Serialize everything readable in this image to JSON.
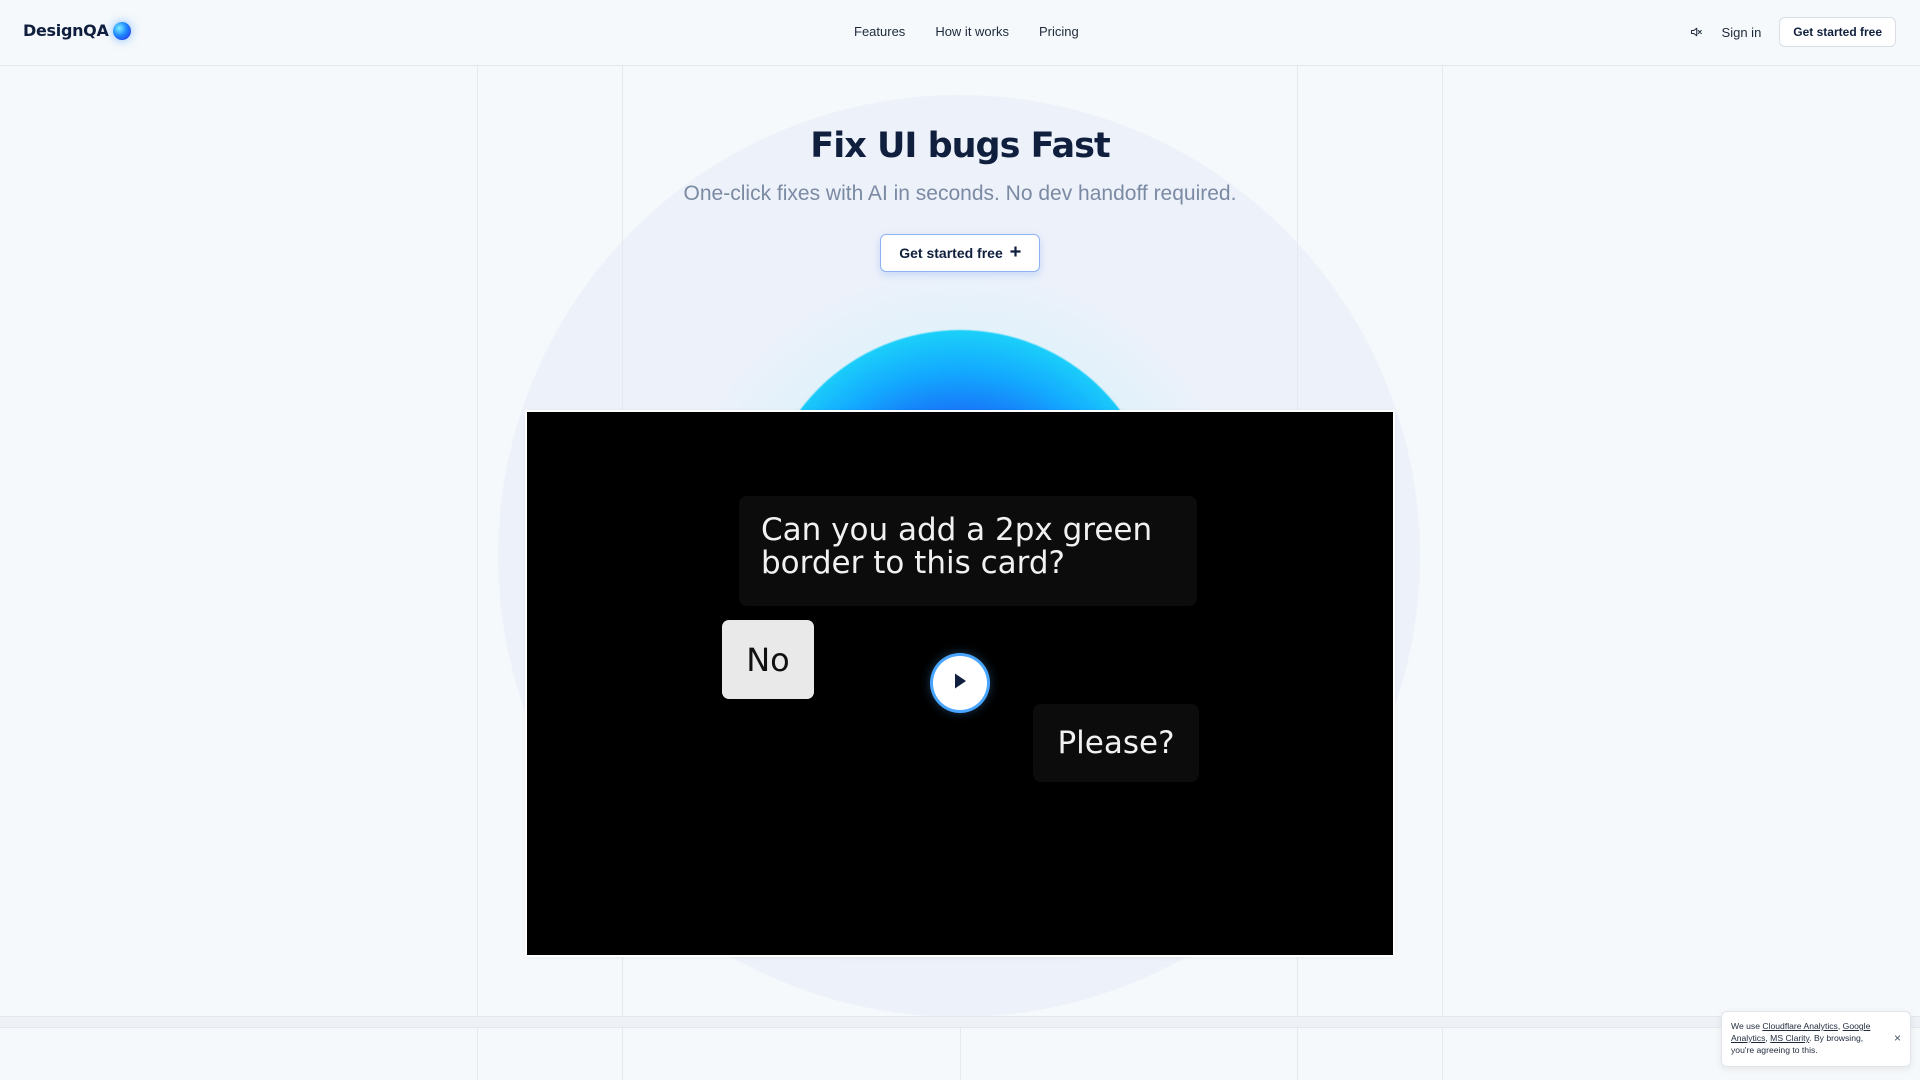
{
  "header": {
    "logo_text": "DesignQA",
    "nav": [
      "Features",
      "How it works",
      "Pricing"
    ],
    "mute_icon": "volume-mute-icon",
    "signin_label": "Sign in",
    "cta_label": "Get started free"
  },
  "hero": {
    "title": "Fix UI bugs Fast",
    "subtitle": "One-click fixes with AI in seconds. No dev handoff required.",
    "cta_label": "Get started free",
    "cta_icon": "plus-icon"
  },
  "video": {
    "question": "Can you add a 2px green border to this card?",
    "reply_no": "No",
    "reply_please": "Please?",
    "play_icon": "play-icon"
  },
  "cookie": {
    "prefix": "We use ",
    "link1": "Cloudflare Analytics",
    "sep1": ", ",
    "link2": "Google Analytics",
    "sep2": ", ",
    "link3": "MS Clarity",
    "suffix": ". By browsing, you're agreeing to this.",
    "close": "×"
  },
  "colors": {
    "background": "#f6f9fb",
    "heading": "#0f1f3d",
    "subtitle": "#7b8aa3",
    "accent": "#1e88ff"
  }
}
